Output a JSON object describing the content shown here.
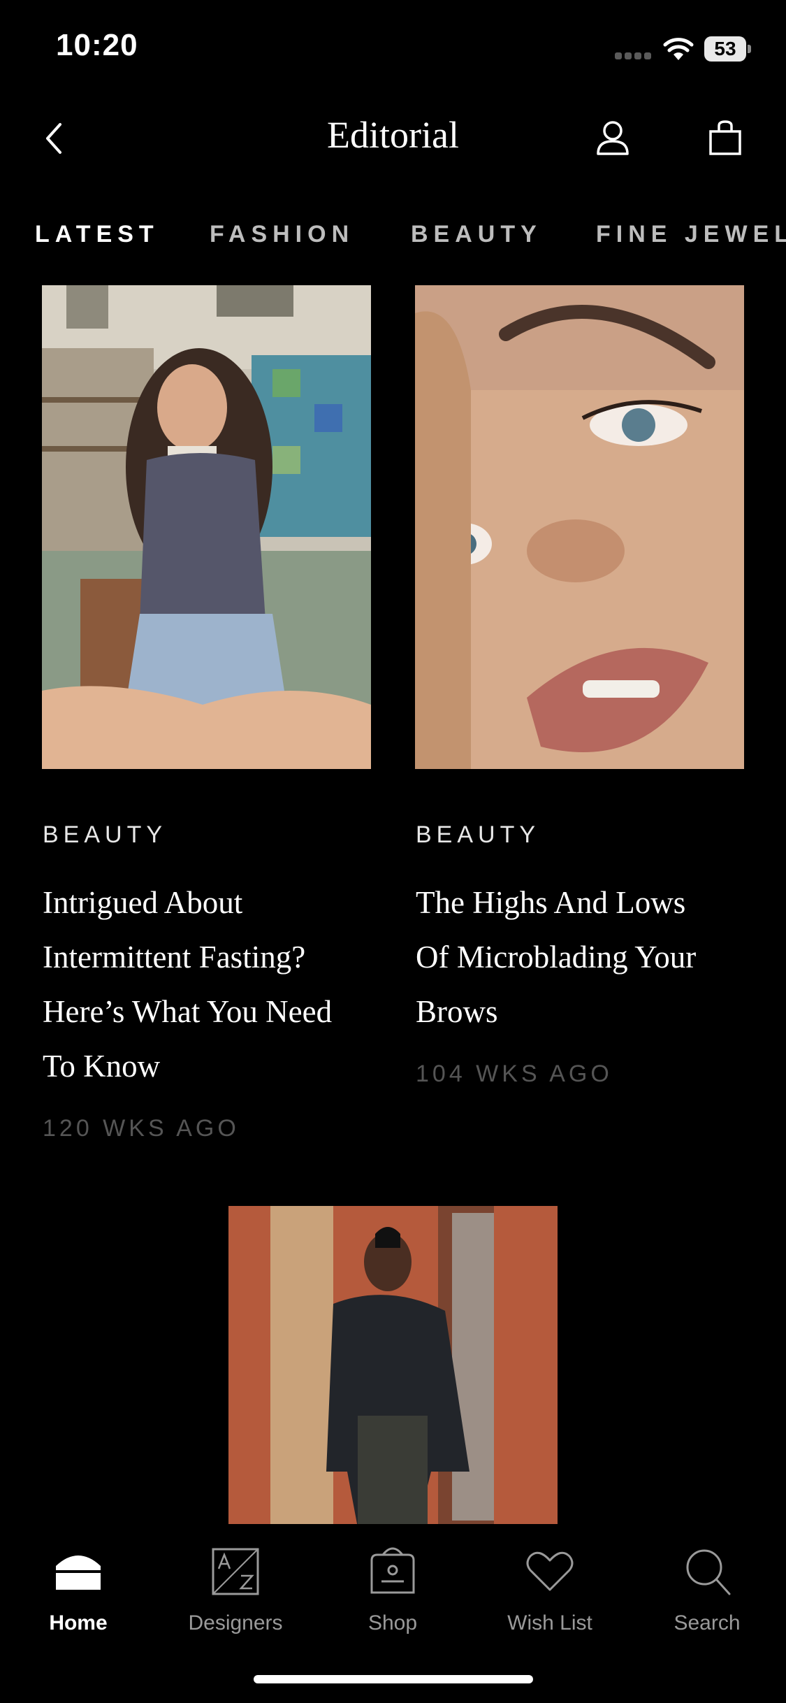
{
  "status": {
    "time": "10:20",
    "battery": "53"
  },
  "header": {
    "title": "Editorial"
  },
  "tabs": [
    {
      "label": "LATEST",
      "active": true
    },
    {
      "label": "FASHION",
      "active": false
    },
    {
      "label": "BEAUTY",
      "active": false
    },
    {
      "label": "FINE JEWEL",
      "active": false
    }
  ],
  "articles": [
    {
      "category": "BEAUTY",
      "lines": [
        "Intrigued About",
        "Intermittent Fasting?",
        "Here’s What You Need",
        "To Know"
      ],
      "time": "120 WKS AGO"
    },
    {
      "category": "BEAUTY",
      "lines": [
        "The Highs And Lows",
        "Of Microblading Your",
        "Brows"
      ],
      "time": "104 WKS AGO"
    }
  ],
  "tabbar": {
    "items": [
      {
        "label": "Home",
        "icon": "home-icon",
        "active": true
      },
      {
        "label": "Designers",
        "icon": "az-icon",
        "active": false
      },
      {
        "label": "Shop",
        "icon": "shop-bag-icon",
        "active": false
      },
      {
        "label": "Wish List",
        "icon": "heart-icon",
        "active": false
      },
      {
        "label": "Search",
        "icon": "search-icon",
        "active": false
      }
    ]
  }
}
